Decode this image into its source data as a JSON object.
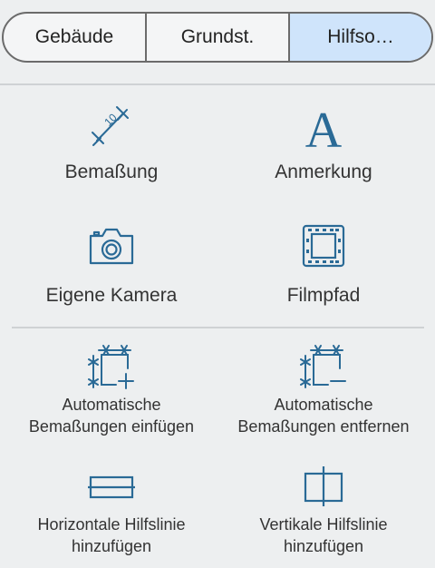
{
  "tabs": [
    {
      "label": "Gebäude"
    },
    {
      "label": "Grundst."
    },
    {
      "label": "Hilfso…"
    }
  ],
  "tools": {
    "dimension": {
      "label": "Bemaßung",
      "icon": "dimension-icon",
      "value": "10"
    },
    "annotation": {
      "label": "Anmerkung",
      "icon": "text-annotation-icon",
      "glyph": "A"
    },
    "camera": {
      "label": "Eigene Kamera",
      "icon": "camera-icon"
    },
    "filmpath": {
      "label": "Filmpfad",
      "icon": "film-strip-icon"
    }
  },
  "helpers": {
    "auto_add": {
      "line1": "Automatische",
      "line2": "Bemaßungen einfügen",
      "icon": "auto-dimension-add-icon"
    },
    "auto_remove": {
      "line1": "Automatische",
      "line2": "Bemaßungen entfernen",
      "icon": "auto-dimension-remove-icon"
    },
    "horizontal": {
      "line1": "Horizontale Hilfslinie",
      "line2": "hinzufügen",
      "icon": "horizontal-guide-icon"
    },
    "vertical": {
      "line1": "Vertikale Hilfslinie",
      "line2": "hinzufügen",
      "icon": "vertical-guide-icon"
    }
  },
  "colors": {
    "icon": "#2a6a96",
    "active_tab": "#cfe4fb"
  }
}
